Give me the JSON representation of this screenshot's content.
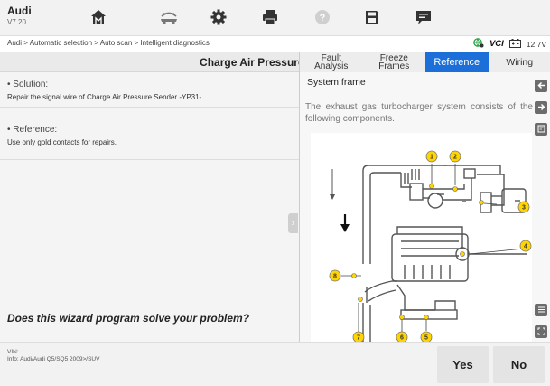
{
  "app": {
    "name": "Audi",
    "version": "V7.20"
  },
  "toolbar": {
    "icons": [
      "home-icon",
      "vehicle-menu-icon",
      "settings-icon",
      "print-icon",
      "help-icon",
      "save-icon",
      "chat-icon"
    ]
  },
  "breadcrumb": "Audi > Automatic selection > Auto scan > Intelligent diagnostics",
  "status": {
    "vci": "VCI",
    "voltage": "12.7V"
  },
  "left_panel": {
    "title": "Charge Air Pressure S",
    "solution_heading": "Solution:",
    "solution_text": "Repair the signal wire of Charge Air Pressure Sender -YP31-.",
    "reference_heading": "Reference:",
    "reference_text": "Use only gold contacts for repairs.",
    "wizard_question": "Does this wizard program solve your problem?"
  },
  "tabs": [
    {
      "line1": "Fault",
      "line2": "Analysis",
      "active": false
    },
    {
      "line1": "Freeze",
      "line2": "Frames",
      "active": false
    },
    {
      "line1": "Reference",
      "line2": "",
      "active": true
    },
    {
      "line1": "Wiring",
      "line2": "",
      "active": false
    }
  ],
  "right_panel": {
    "section_title": "System frame",
    "description": "The exhaust gas turbocharger system consists of the following components.",
    "diagram_labels": [
      "1",
      "2",
      "3",
      "4",
      "5",
      "6",
      "7",
      "8"
    ]
  },
  "bottom": {
    "vin_label": "VIN:",
    "info": "Info: Audi/Audi Q5/SQ5 2009>/SUV",
    "yes": "Yes",
    "no": "No"
  },
  "colors": {
    "accent": "#1c6fd9",
    "diagram_callout": "#ffd400"
  }
}
